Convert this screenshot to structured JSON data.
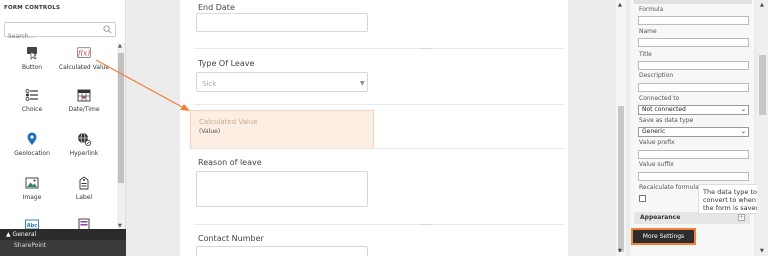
{
  "left_panel": {
    "title": "FORM CONTROLS",
    "search_placeholder": "Search...",
    "controls": [
      {
        "label": "Button",
        "icon": "button-icon"
      },
      {
        "label": "Calculated Value",
        "icon": "function-icon"
      },
      {
        "label": "Choice",
        "icon": "choice-list-icon"
      },
      {
        "label": "Date/Time",
        "icon": "calendar-icon"
      },
      {
        "label": "Geolocation",
        "icon": "map-pin-icon"
      },
      {
        "label": "Hyperlink",
        "icon": "globe-icon"
      },
      {
        "label": "Image",
        "icon": "image-icon"
      },
      {
        "label": "Label",
        "icon": "label-icon"
      },
      {
        "label": "",
        "icon": "abc-textbox-icon"
      },
      {
        "label": "",
        "icon": "form-icon"
      }
    ],
    "section_general": "General",
    "section_sharepoint": "SharePoint"
  },
  "canvas": {
    "end_date_label": "End Date",
    "type_of_leave_label": "Type Of Leave",
    "type_of_leave_value": "Sick",
    "calculated_value_title": "Calculated Value",
    "calculated_value_text": "(Value)",
    "reason_label": "Reason of leave",
    "contact_label": "Contact Number"
  },
  "properties": {
    "formula_label": "Formula",
    "name_label": "Name",
    "title_label": "Title",
    "description_label": "Description",
    "connected_to_label": "Connected to",
    "connected_to_value": "Not connected",
    "save_as_label": "Save as data type",
    "save_as_value": "Generic",
    "value_prefix_label": "Value prefix",
    "value_suffix_label": "Value suffix",
    "recalc_label": "Recalculate formula o",
    "appearance_label": "Appearance",
    "more_settings_label": "More Settings",
    "tooltip_text": "The data type to convert to when the form is saved."
  },
  "colors": {
    "accent_orange": "#f47f38",
    "calc_highlight": "#fdeee3",
    "dark_button": "#2d2d2d"
  }
}
